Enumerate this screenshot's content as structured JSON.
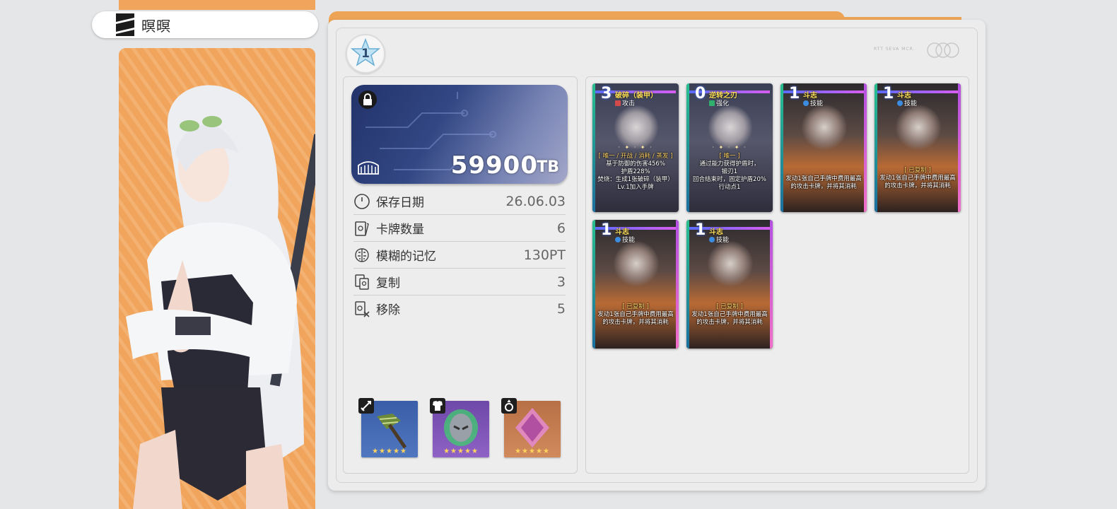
{
  "character": {
    "name": "暝暝"
  },
  "rank": {
    "level": "1"
  },
  "header": {
    "deco_text": "RTT SEVA MCR."
  },
  "currency": {
    "value": "59900",
    "unit": "TB"
  },
  "stats": [
    {
      "label": "保存日期",
      "value": "26.06.03",
      "icon": "clock-icon"
    },
    {
      "label": "卡牌数量",
      "value": "6",
      "icon": "cards-icon"
    },
    {
      "label": "模糊的记忆",
      "value": "130PT",
      "icon": "brain-icon"
    },
    {
      "label": "复制",
      "value": "3",
      "icon": "copy-icon"
    },
    {
      "label": "移除",
      "value": "5",
      "icon": "remove-icon"
    }
  ],
  "equipment": [
    {
      "slot": "weapon",
      "icon": "sword-icon",
      "item": "hammer-icon",
      "stars": "★★★★★",
      "color": "#3f6bb3"
    },
    {
      "slot": "armor",
      "icon": "armor-icon",
      "item": "mask-icon",
      "stars": "★★★★★",
      "color": "#7d55b5"
    },
    {
      "slot": "ring",
      "icon": "ring-icon",
      "item": "crystal-icon",
      "stars": "★★★★★",
      "color": "#c27a4e"
    }
  ],
  "cards": [
    {
      "cost": "3",
      "name": "破碎（装甲）",
      "type": "攻击",
      "tag": "[ 唯一 / 开战 / 消耗 / 蒸发 ]",
      "desc": "基于防御的伤害456%\n护盾228%\n焚烧：生成1张破碎（装甲）Lv.1加入手牌"
    },
    {
      "cost": "0",
      "name": "逆转之刃",
      "type": "强化",
      "tag": "[ 唯一 ]",
      "desc": "通过能力获得护盾时，\n锻刃1\n回合结束时，固定护盾20%\n行动点1"
    },
    {
      "cost": "1",
      "name": "斗志",
      "type": "技能",
      "tag": "",
      "desc": "发动1张自己手牌中费用最高的攻击卡牌，并将其消耗"
    },
    {
      "cost": "1",
      "name": "斗志",
      "type": "技能",
      "tag": "[ 已复制 ]",
      "desc": "发动1张自己手牌中费用最高的攻击卡牌，并将其消耗"
    },
    {
      "cost": "1",
      "name": "斗志",
      "type": "技能",
      "tag": "[ 已复制 ]",
      "desc": "发动1张自己手牌中费用最高的攻击卡牌，并将其消耗"
    },
    {
      "cost": "1",
      "name": "斗志",
      "type": "技能",
      "tag": "[ 已复制 ]",
      "desc": "发动1张自己手牌中费用最高的攻击卡牌，并将其消耗"
    }
  ],
  "colors": {
    "accent_orange": "#f0a45c",
    "panel_bg": "#ececec",
    "currency_card": "#324784"
  }
}
